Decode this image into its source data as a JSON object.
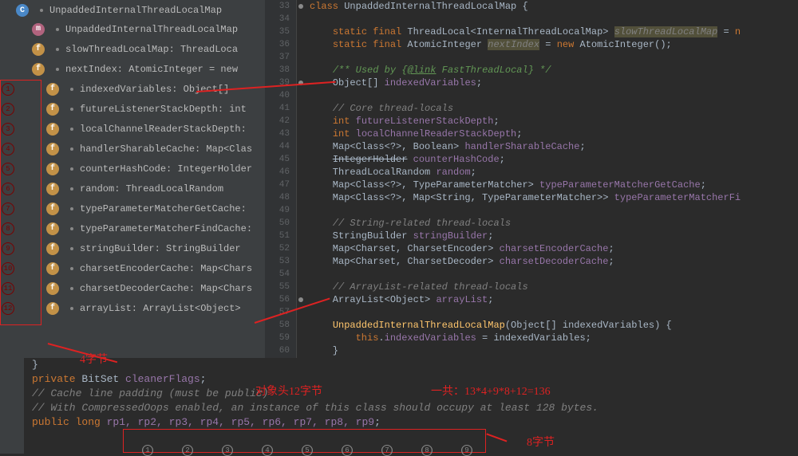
{
  "sidebar": {
    "items": [
      {
        "icon": "C",
        "iconClass": "icon-class",
        "label": "UnpaddedInternalThreadLocalMap",
        "pad": 20
      },
      {
        "icon": "m",
        "iconClass": "icon-method",
        "label": "UnpaddedInternalThreadLocalMap",
        "pad": 40
      },
      {
        "icon": "f",
        "iconClass": "icon-field",
        "label": "slowThreadLocalMap: ThreadLoca",
        "pad": 40,
        "lock": true
      },
      {
        "icon": "f",
        "iconClass": "icon-field",
        "label": "nextIndex: AtomicInteger = new",
        "pad": 40,
        "lock": true
      },
      {
        "icon": "f",
        "iconClass": "icon-field",
        "label": "indexedVariables: Object[]",
        "pad": 40,
        "num": "1"
      },
      {
        "icon": "f",
        "iconClass": "icon-field",
        "label": "futureListenerStackDepth: int",
        "pad": 40,
        "num": "2"
      },
      {
        "icon": "f",
        "iconClass": "icon-field",
        "label": "localChannelReaderStackDepth:",
        "pad": 40,
        "num": "3"
      },
      {
        "icon": "f",
        "iconClass": "icon-field",
        "label": "handlerSharableCache: Map<Clas",
        "pad": 40,
        "num": "4"
      },
      {
        "icon": "f",
        "iconClass": "icon-field",
        "label": "counterHashCode: IntegerHolder",
        "pad": 40,
        "num": "5"
      },
      {
        "icon": "f",
        "iconClass": "icon-field",
        "label": "random: ThreadLocalRandom",
        "pad": 40,
        "num": "6"
      },
      {
        "icon": "f",
        "iconClass": "icon-field",
        "label": "typeParameterMatcherGetCache:",
        "pad": 40,
        "num": "7"
      },
      {
        "icon": "f",
        "iconClass": "icon-field",
        "label": "typeParameterMatcherFindCache:",
        "pad": 40,
        "num": "8"
      },
      {
        "icon": "f",
        "iconClass": "icon-field",
        "label": "stringBuilder: StringBuilder",
        "pad": 40,
        "num": "9"
      },
      {
        "icon": "f",
        "iconClass": "icon-field",
        "label": "charsetEncoderCache: Map<Chars",
        "pad": 40,
        "num": "10"
      },
      {
        "icon": "f",
        "iconClass": "icon-field",
        "label": "charsetDecoderCache: Map<Chars",
        "pad": 40,
        "num": "11"
      },
      {
        "icon": "f",
        "iconClass": "icon-field",
        "label": "arrayList: ArrayList<Object>",
        "pad": 40,
        "num": "12"
      }
    ]
  },
  "gutter": {
    "start": 33,
    "end": 60
  },
  "code": {
    "lines": [
      {
        "n": 33,
        "html": "<span class='kw'>class</span> <span class='type'>UnpaddedInternalThreadLocalMap</span> {",
        "dot": true
      },
      {
        "n": 34,
        "html": ""
      },
      {
        "n": 35,
        "html": "    <span class='kw'>static final</span> ThreadLocal&lt;InternalThreadLocalMap&gt; <span class='hl-bg'>slowThreadLocalMap</span> = <span class='kw'>n</span>"
      },
      {
        "n": 36,
        "html": "    <span class='kw'>static final</span> AtomicInteger <span class='hl-bg'>nextIndex</span> = <span class='kw'>new</span> AtomicInteger();"
      },
      {
        "n": 37,
        "html": ""
      },
      {
        "n": 38,
        "html": "    <span class='doc'>/** Used by {</span><span class='doc-tag'>@link</span><span class='doc'> </span><span class='doc-link'>FastThreadLocal</span><span class='doc'>} */</span>"
      },
      {
        "n": 39,
        "html": "    Object[] <span class='purple'>indexedVariables</span>;",
        "dot": true
      },
      {
        "n": 40,
        "html": ""
      },
      {
        "n": 41,
        "html": "    <span class='comment'>// Core thread-locals</span>"
      },
      {
        "n": 42,
        "html": "    <span class='kw'>int</span> <span class='purple'>futureListenerStackDepth</span>;"
      },
      {
        "n": 43,
        "html": "    <span class='kw'>int</span> <span class='purple'>localChannelReaderStackDepth</span>;"
      },
      {
        "n": 44,
        "html": "    Map&lt;Class&lt;?&gt;, Boolean&gt; <span class='purple'>handlerSharableCache</span>;"
      },
      {
        "n": 45,
        "html": "    <span class='strike'>IntegerHolder</span> <span class='purple'>counterHashCode</span>;"
      },
      {
        "n": 46,
        "html": "    ThreadLocalRandom <span class='purple'>random</span>;"
      },
      {
        "n": 47,
        "html": "    Map&lt;Class&lt;?&gt;, TypeParameterMatcher&gt; <span class='purple'>typeParameterMatcherGetCache</span>;"
      },
      {
        "n": 48,
        "html": "    Map&lt;Class&lt;?&gt;, Map&lt;String, TypeParameterMatcher&gt;&gt; <span class='purple'>typeParameterMatcherFi</span>"
      },
      {
        "n": 49,
        "html": ""
      },
      {
        "n": 50,
        "html": "    <span class='comment'>// String-related thread-locals</span>"
      },
      {
        "n": 51,
        "html": "    StringBuilder <span class='purple'>stringBuilder</span>;"
      },
      {
        "n": 52,
        "html": "    Map&lt;Charset, CharsetEncoder&gt; <span class='purple'>charsetEncoderCache</span>;"
      },
      {
        "n": 53,
        "html": "    Map&lt;Charset, CharsetDecoder&gt; <span class='purple'>charsetDecoderCache</span>;"
      },
      {
        "n": 54,
        "html": ""
      },
      {
        "n": 55,
        "html": "    <span class='comment'>// ArrayList-related thread-locals</span>"
      },
      {
        "n": 56,
        "html": "    ArrayList&lt;Object&gt; <span class='purple'>arrayList</span>;",
        "dot": true
      },
      {
        "n": 57,
        "html": ""
      },
      {
        "n": 58,
        "html": "    <span class='fn'>UnpaddedInternalThreadLocalMap</span>(Object[] indexedVariables) {"
      },
      {
        "n": 59,
        "html": "        <span class='kw'>this</span>.<span class='purple'>indexedVariables</span> = indexedVariables;"
      },
      {
        "n": 60,
        "html": "    }"
      }
    ]
  },
  "bottom": {
    "l1": "}",
    "l2_pre": "private ",
    "l2_type": "BitSet ",
    "l2_var": "cleanerFlags",
    "l2_post": ";",
    "l3": "// Cache line padding (must be public)",
    "l4": "// With CompressedOops enabled, an instance of this class should occupy at least 128 bytes.",
    "l5_pre": "public long ",
    "l5_vars": "rp1, rp2, rp3, rp4, rp5, rp6, rp7, rp8, rp9",
    "l5_post": ";"
  },
  "annotations": {
    "a4bytes": "4字节",
    "aObjHeader": "对象头12字节",
    "aTotal": "一共：13*4+9*8+12=136",
    "a8bytes": "8字节",
    "small_nums": [
      "(1)",
      "(2)",
      "(3)",
      "(4)",
      "(5)",
      "(6)",
      "(7)",
      "(8)",
      "(9)"
    ]
  }
}
